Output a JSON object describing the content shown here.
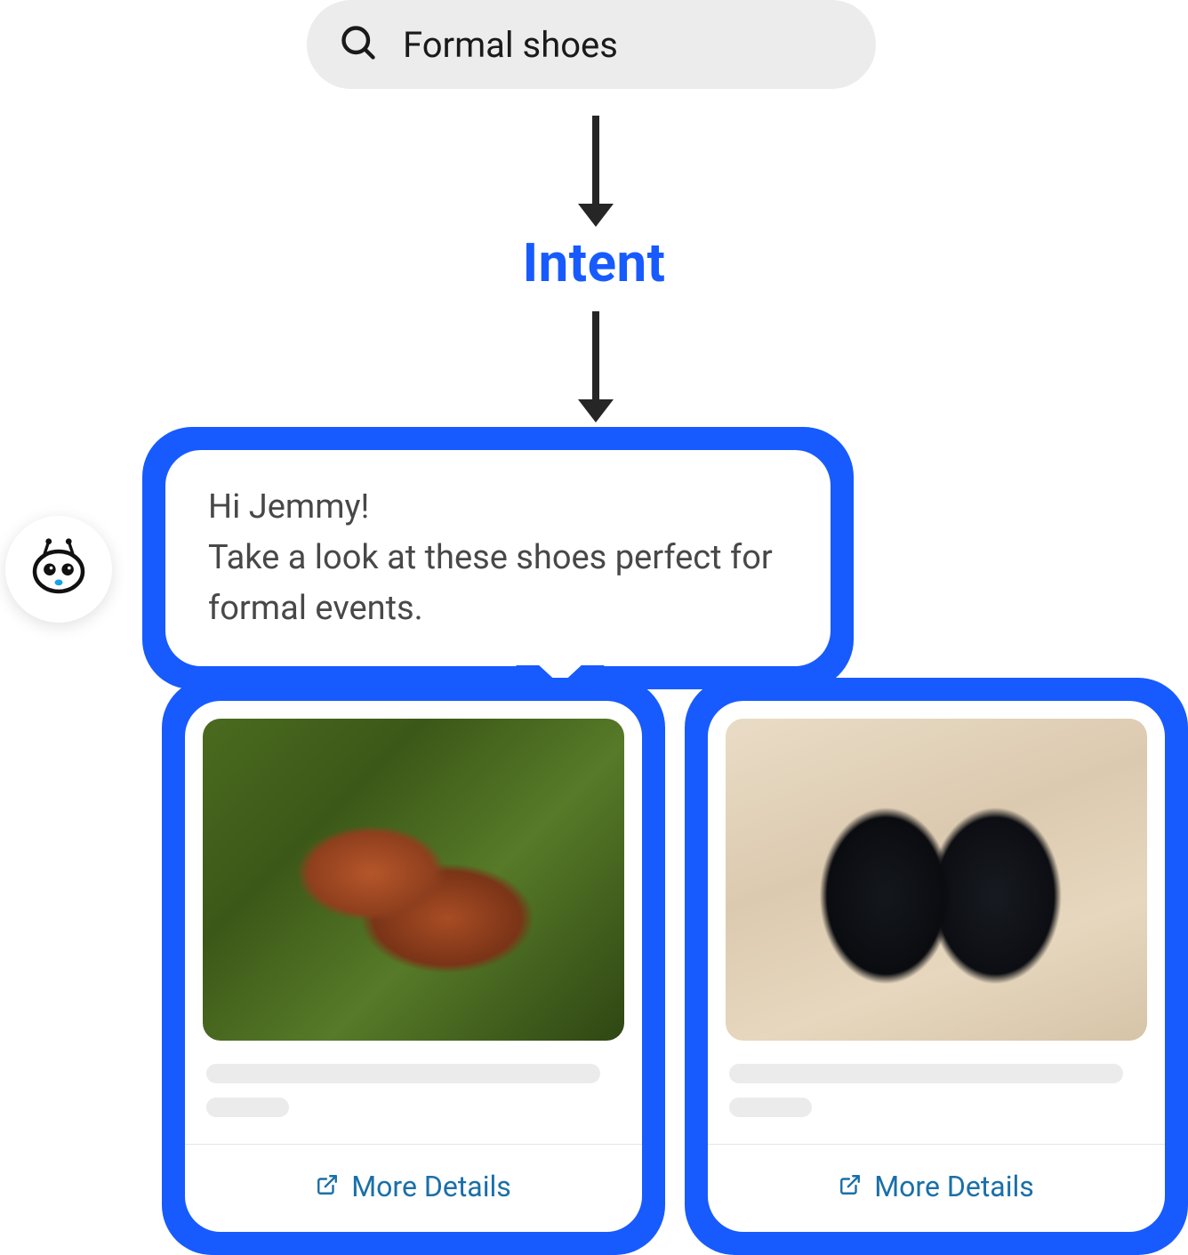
{
  "search": {
    "query": "Formal shoes"
  },
  "flow": {
    "intent_label": "Intent"
  },
  "chat": {
    "greeting": "Hi Jemmy!",
    "body": "Take a look at these shoes perfect for formal events."
  },
  "cards": [
    {
      "cta": "More Details",
      "image_name": "brown-leather-oxford-shoes"
    },
    {
      "cta": "More Details",
      "image_name": "black-leather-dress-shoes"
    }
  ],
  "icons": {
    "search": "search-icon",
    "bot": "bot-avatar-icon",
    "external": "external-link-icon"
  }
}
